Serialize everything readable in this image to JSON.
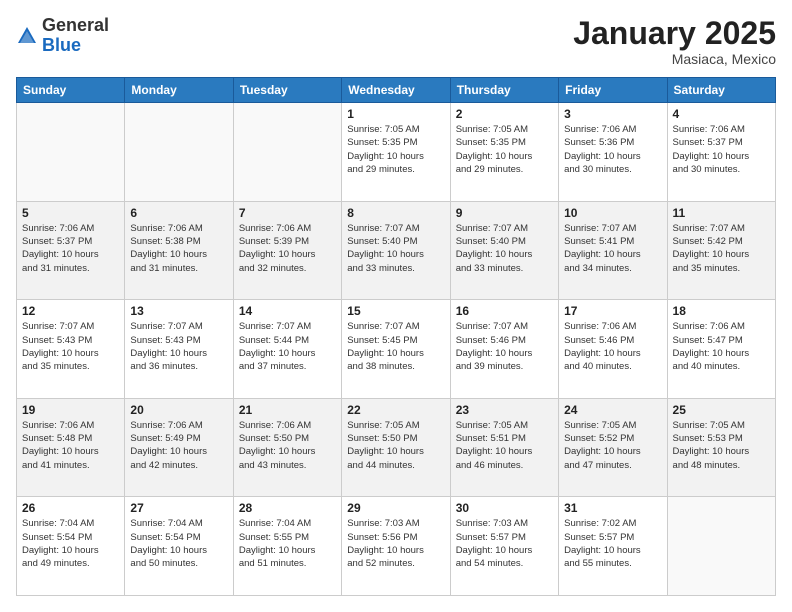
{
  "header": {
    "logo": {
      "general": "General",
      "blue": "Blue"
    },
    "title": "January 2025",
    "location": "Masiaca, Mexico"
  },
  "weekdays": [
    "Sunday",
    "Monday",
    "Tuesday",
    "Wednesday",
    "Thursday",
    "Friday",
    "Saturday"
  ],
  "weeks": [
    {
      "alt": false,
      "days": [
        {
          "num": "",
          "info": ""
        },
        {
          "num": "",
          "info": ""
        },
        {
          "num": "",
          "info": ""
        },
        {
          "num": "1",
          "info": "Sunrise: 7:05 AM\nSunset: 5:35 PM\nDaylight: 10 hours\nand 29 minutes."
        },
        {
          "num": "2",
          "info": "Sunrise: 7:05 AM\nSunset: 5:35 PM\nDaylight: 10 hours\nand 29 minutes."
        },
        {
          "num": "3",
          "info": "Sunrise: 7:06 AM\nSunset: 5:36 PM\nDaylight: 10 hours\nand 30 minutes."
        },
        {
          "num": "4",
          "info": "Sunrise: 7:06 AM\nSunset: 5:37 PM\nDaylight: 10 hours\nand 30 minutes."
        }
      ]
    },
    {
      "alt": true,
      "days": [
        {
          "num": "5",
          "info": "Sunrise: 7:06 AM\nSunset: 5:37 PM\nDaylight: 10 hours\nand 31 minutes."
        },
        {
          "num": "6",
          "info": "Sunrise: 7:06 AM\nSunset: 5:38 PM\nDaylight: 10 hours\nand 31 minutes."
        },
        {
          "num": "7",
          "info": "Sunrise: 7:06 AM\nSunset: 5:39 PM\nDaylight: 10 hours\nand 32 minutes."
        },
        {
          "num": "8",
          "info": "Sunrise: 7:07 AM\nSunset: 5:40 PM\nDaylight: 10 hours\nand 33 minutes."
        },
        {
          "num": "9",
          "info": "Sunrise: 7:07 AM\nSunset: 5:40 PM\nDaylight: 10 hours\nand 33 minutes."
        },
        {
          "num": "10",
          "info": "Sunrise: 7:07 AM\nSunset: 5:41 PM\nDaylight: 10 hours\nand 34 minutes."
        },
        {
          "num": "11",
          "info": "Sunrise: 7:07 AM\nSunset: 5:42 PM\nDaylight: 10 hours\nand 35 minutes."
        }
      ]
    },
    {
      "alt": false,
      "days": [
        {
          "num": "12",
          "info": "Sunrise: 7:07 AM\nSunset: 5:43 PM\nDaylight: 10 hours\nand 35 minutes."
        },
        {
          "num": "13",
          "info": "Sunrise: 7:07 AM\nSunset: 5:43 PM\nDaylight: 10 hours\nand 36 minutes."
        },
        {
          "num": "14",
          "info": "Sunrise: 7:07 AM\nSunset: 5:44 PM\nDaylight: 10 hours\nand 37 minutes."
        },
        {
          "num": "15",
          "info": "Sunrise: 7:07 AM\nSunset: 5:45 PM\nDaylight: 10 hours\nand 38 minutes."
        },
        {
          "num": "16",
          "info": "Sunrise: 7:07 AM\nSunset: 5:46 PM\nDaylight: 10 hours\nand 39 minutes."
        },
        {
          "num": "17",
          "info": "Sunrise: 7:06 AM\nSunset: 5:46 PM\nDaylight: 10 hours\nand 40 minutes."
        },
        {
          "num": "18",
          "info": "Sunrise: 7:06 AM\nSunset: 5:47 PM\nDaylight: 10 hours\nand 40 minutes."
        }
      ]
    },
    {
      "alt": true,
      "days": [
        {
          "num": "19",
          "info": "Sunrise: 7:06 AM\nSunset: 5:48 PM\nDaylight: 10 hours\nand 41 minutes."
        },
        {
          "num": "20",
          "info": "Sunrise: 7:06 AM\nSunset: 5:49 PM\nDaylight: 10 hours\nand 42 minutes."
        },
        {
          "num": "21",
          "info": "Sunrise: 7:06 AM\nSunset: 5:50 PM\nDaylight: 10 hours\nand 43 minutes."
        },
        {
          "num": "22",
          "info": "Sunrise: 7:05 AM\nSunset: 5:50 PM\nDaylight: 10 hours\nand 44 minutes."
        },
        {
          "num": "23",
          "info": "Sunrise: 7:05 AM\nSunset: 5:51 PM\nDaylight: 10 hours\nand 46 minutes."
        },
        {
          "num": "24",
          "info": "Sunrise: 7:05 AM\nSunset: 5:52 PM\nDaylight: 10 hours\nand 47 minutes."
        },
        {
          "num": "25",
          "info": "Sunrise: 7:05 AM\nSunset: 5:53 PM\nDaylight: 10 hours\nand 48 minutes."
        }
      ]
    },
    {
      "alt": false,
      "days": [
        {
          "num": "26",
          "info": "Sunrise: 7:04 AM\nSunset: 5:54 PM\nDaylight: 10 hours\nand 49 minutes."
        },
        {
          "num": "27",
          "info": "Sunrise: 7:04 AM\nSunset: 5:54 PM\nDaylight: 10 hours\nand 50 minutes."
        },
        {
          "num": "28",
          "info": "Sunrise: 7:04 AM\nSunset: 5:55 PM\nDaylight: 10 hours\nand 51 minutes."
        },
        {
          "num": "29",
          "info": "Sunrise: 7:03 AM\nSunset: 5:56 PM\nDaylight: 10 hours\nand 52 minutes."
        },
        {
          "num": "30",
          "info": "Sunrise: 7:03 AM\nSunset: 5:57 PM\nDaylight: 10 hours\nand 54 minutes."
        },
        {
          "num": "31",
          "info": "Sunrise: 7:02 AM\nSunset: 5:57 PM\nDaylight: 10 hours\nand 55 minutes."
        },
        {
          "num": "",
          "info": ""
        }
      ]
    }
  ]
}
